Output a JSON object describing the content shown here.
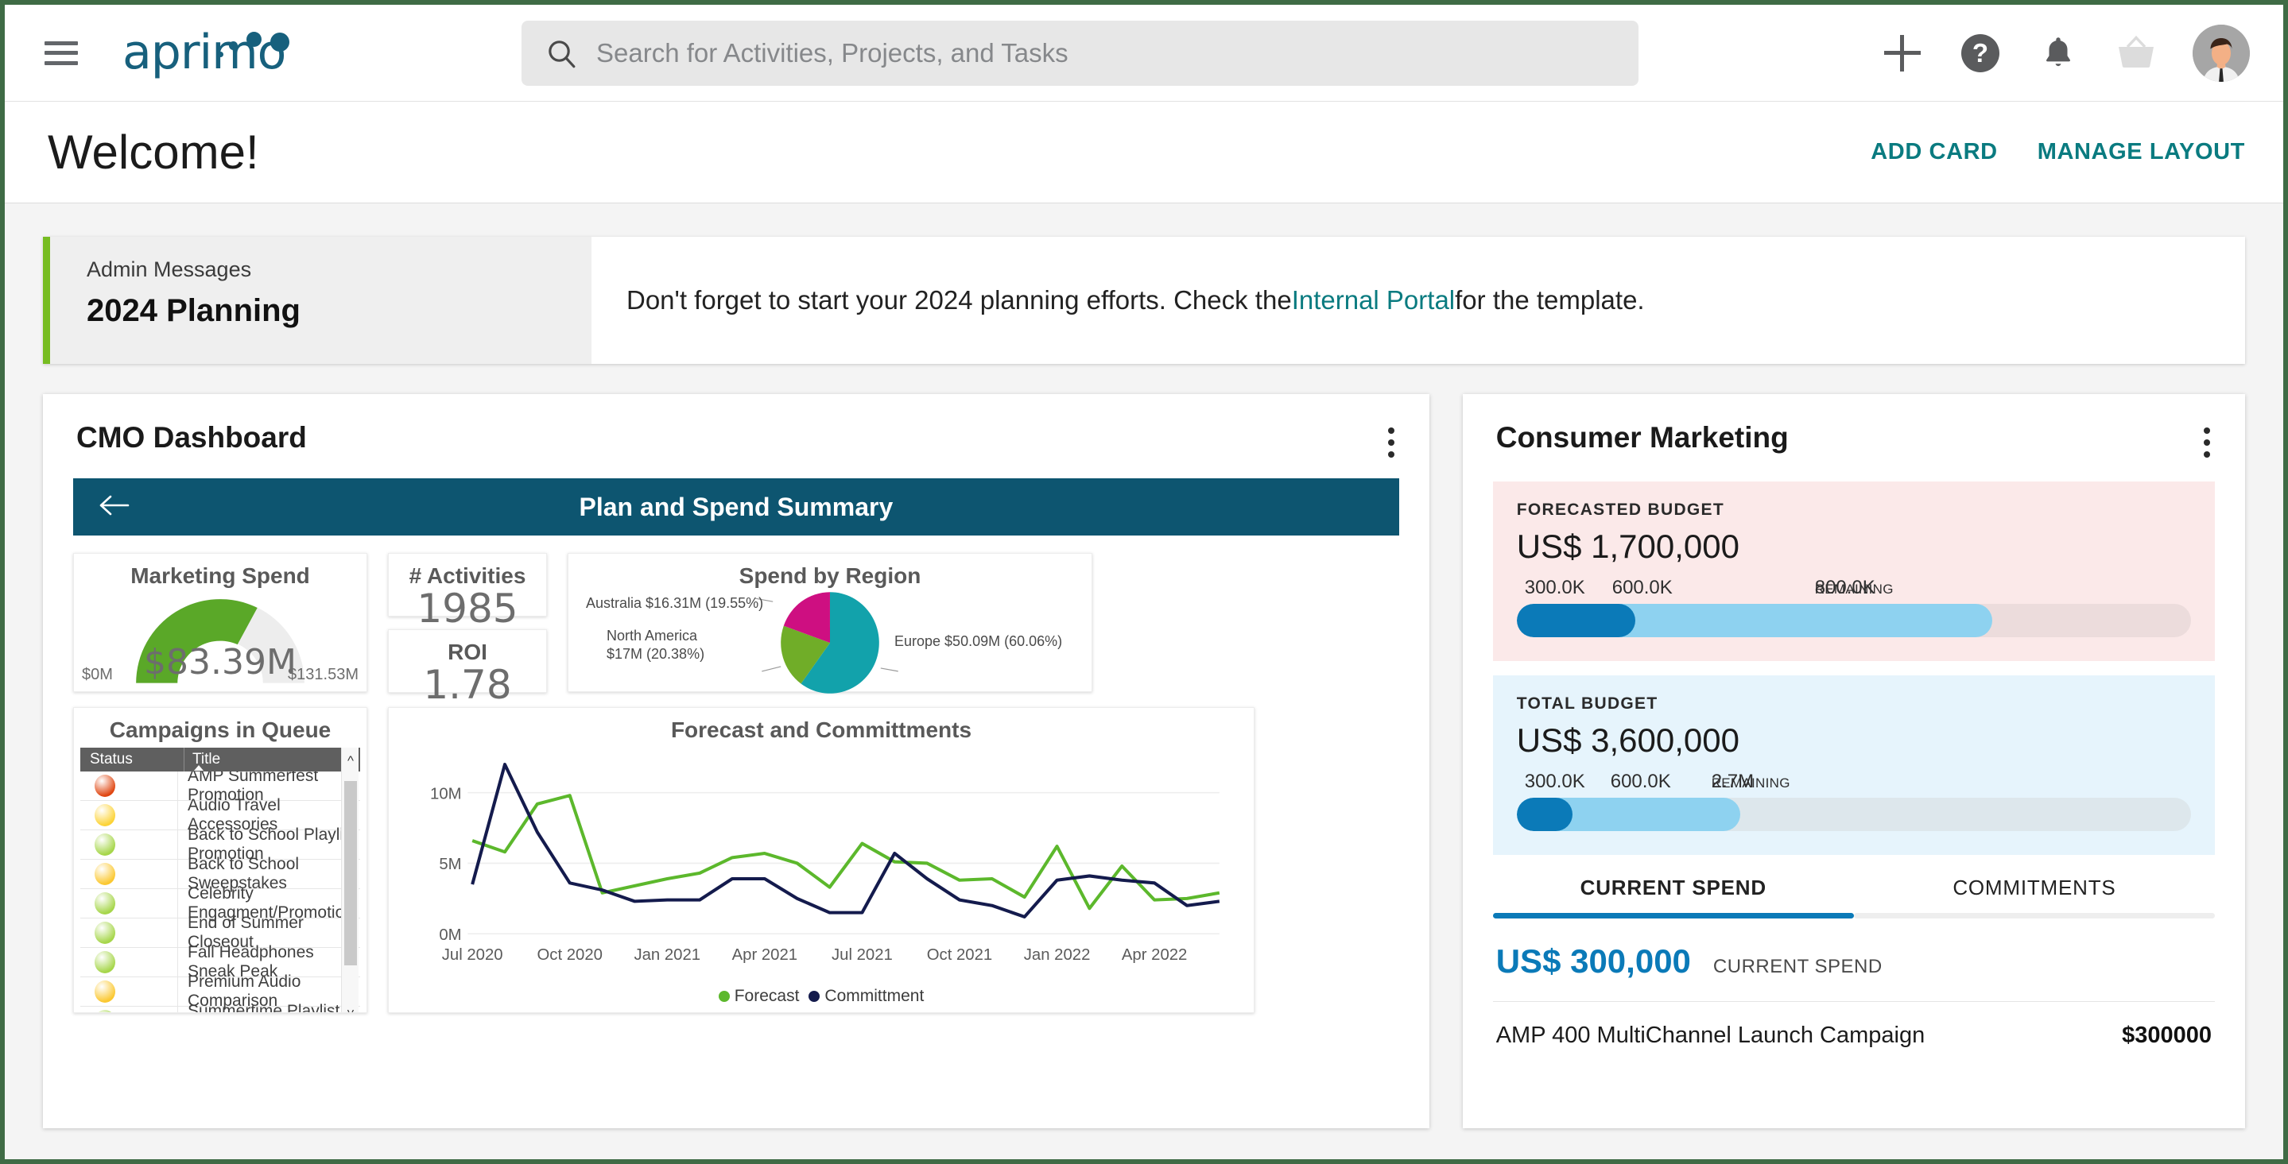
{
  "colors": {
    "teal_link": "#0a7b80",
    "brand_blue": "#17607d",
    "header_bar": "#0d5570",
    "green_accent": "#76bc21",
    "gauge_green": "#5aa828",
    "pie_europe": "#12a2ab",
    "pie_north_america": "#70ad28",
    "pie_australia": "#ce0f81",
    "forecast_green": "#5cb82c",
    "committment_navy": "#141b4d",
    "progress_dark": "#0b7ab8",
    "progress_light": "#8ed2f0",
    "frame_border": "#3f6b45"
  },
  "topbar": {
    "menu_icon": "hamburger-icon",
    "logo_text": "aprimo",
    "search": {
      "placeholder": "Search for Activities, Projects, and Tasks",
      "value": ""
    },
    "icons": [
      "plus-icon",
      "help-icon",
      "bell-icon",
      "basket-icon",
      "avatar"
    ],
    "help_glyph": "?"
  },
  "welcome": {
    "title": "Welcome!",
    "add_card_label": "ADD CARD",
    "manage_layout_label": "MANAGE LAYOUT"
  },
  "banner": {
    "label": "Admin Messages",
    "title": "2024 Planning",
    "message_before": "Don't forget to start your 2024 planning efforts. Check the ",
    "link_text": "Internal Portal",
    "message_after": " for the template."
  },
  "cmo_card": {
    "title": "CMO Dashboard",
    "menu_icon": "kebab-menu-icon",
    "plan_spend_title": "Plan and Spend Summary",
    "back_icon": "arrow-left-icon",
    "marketing_spend": {
      "title": "Marketing Spend",
      "value_label": "$83.39M",
      "min_label": "$0M",
      "max_label": "$131.53M",
      "percent": 63.4
    },
    "activities": {
      "title": "# Activities",
      "value": "1985"
    },
    "roi": {
      "title": "ROI",
      "value": "1.78"
    },
    "queue": {
      "title": "Campaigns in Queue",
      "columns": [
        "Status",
        "Title"
      ],
      "sort_column": "Title",
      "rows": [
        {
          "status_color": "#e04611",
          "title": "AMP Summerfest Promotion"
        },
        {
          "status_color": "#fcd337",
          "title": "Audio Travel Accessories"
        },
        {
          "status_color": "#a6d64a",
          "title": "Back to School Playlist Promotion"
        },
        {
          "status_color": "#fbc831",
          "title": "Back to School Sweepstakes"
        },
        {
          "status_color": "#a6d64a",
          "title": "Celebrity Engagment/Promotion"
        },
        {
          "status_color": "#a6d64a",
          "title": "End of Summer Closeout"
        },
        {
          "status_color": "#a6d64a",
          "title": "Fall Headphones Sneak Peak"
        },
        {
          "status_color": "#fbc831",
          "title": "Premium Audio Comparison"
        },
        {
          "status_color": "#a6d64a",
          "title": "Summertime Playlist Promotion"
        }
      ]
    }
  },
  "chart_data": [
    {
      "type": "pie",
      "title": "Spend by Region",
      "legend": "labels-with-leader-lines",
      "slices": [
        {
          "name": "Europe",
          "value": 50.09,
          "unit": "M",
          "percent": 60.06,
          "label": "Europe $50.09M (60.06%)",
          "color": "#12a2ab"
        },
        {
          "name": "North America",
          "value": 17.0,
          "unit": "M",
          "percent": 20.38,
          "label": "North America\n$17M (20.38%)",
          "color": "#70ad28"
        },
        {
          "name": "Australia",
          "value": 16.31,
          "unit": "M",
          "percent": 19.55,
          "label": "Australia $16.31M (19.55%)",
          "color": "#ce0f81"
        }
      ]
    },
    {
      "type": "line",
      "title": "Forecast and Committments",
      "xlabel": "",
      "ylabel": "",
      "ylim": [
        0,
        12
      ],
      "yticks": [
        "0M",
        "5M",
        "10M"
      ],
      "grid": true,
      "legend_position": "bottom",
      "xticks": [
        "Jul 2020",
        "Oct 2020",
        "Jan 2021",
        "Apr 2021",
        "Jul 2021",
        "Oct 2021",
        "Jan 2022",
        "Apr 2022"
      ],
      "x": [
        "Jul 2020",
        "Aug 2020",
        "Sep 2020",
        "Oct 2020",
        "Nov 2020",
        "Dec 2020",
        "Jan 2021",
        "Feb 2021",
        "Mar 2021",
        "Apr 2021",
        "May 2021",
        "Jun 2021",
        "Jul 2021",
        "Aug 2021",
        "Sep 2021",
        "Oct 2021",
        "Nov 2021",
        "Dec 2021",
        "Jan 2022",
        "Feb 2022",
        "Mar 2022",
        "Apr 2022",
        "May 2022",
        "Jun 2022"
      ],
      "series": [
        {
          "name": "Forecast",
          "color": "#5cb82c",
          "values": [
            6.6,
            5.8,
            9.2,
            9.8,
            2.9,
            3.4,
            3.9,
            4.3,
            5.4,
            5.7,
            5.0,
            3.3,
            6.4,
            5.1,
            5.0,
            3.8,
            3.9,
            2.6,
            6.2,
            1.8,
            4.8,
            2.4,
            2.5,
            2.9
          ]
        },
        {
          "name": "Committment",
          "color": "#141b4d",
          "values": [
            3.5,
            12.0,
            7.2,
            3.6,
            3.1,
            2.3,
            2.4,
            2.4,
            3.9,
            3.9,
            2.5,
            1.5,
            1.5,
            5.7,
            3.9,
            2.4,
            2.0,
            1.2,
            3.8,
            4.1,
            3.8,
            3.6,
            2.0,
            2.3
          ]
        }
      ]
    }
  ],
  "consumer_marketing": {
    "title": "Consumer Marketing",
    "menu_icon": "kebab-menu-icon",
    "forecasted_budget": {
      "label": "FORECASTED BUDGET",
      "amount": "US$ 1,700,000",
      "ticks": [
        "300.0K",
        "600.0K",
        "800.0K"
      ],
      "remaining_suffix": "REMAINING",
      "segments": [
        {
          "label": "300.0K",
          "percent": 17.6,
          "color": "#0b7ab8"
        },
        {
          "label": "600.0K",
          "percent": 52.9,
          "color": "#8ed2f0"
        }
      ]
    },
    "total_budget": {
      "label": "TOTAL BUDGET",
      "amount": "US$ 3,600,000",
      "ticks": [
        "300.0K",
        "600.0K",
        "2.7M"
      ],
      "remaining_suffix": "REMAINING",
      "segments": [
        {
          "label": "300.0K",
          "percent": 8.3,
          "color": "#0b7ab8"
        },
        {
          "label": "600.0K",
          "percent": 24.9,
          "color": "#8ed2f0"
        }
      ]
    },
    "tabs": [
      {
        "label": "CURRENT SPEND",
        "active": true
      },
      {
        "label": "COMMITMENTS",
        "active": false
      }
    ],
    "current_spend": {
      "amount": "US$ 300,000",
      "label": "CURRENT SPEND"
    },
    "campaign": {
      "name": "AMP 400 MultiChannel Launch Campaign",
      "amount": "$300000"
    }
  }
}
